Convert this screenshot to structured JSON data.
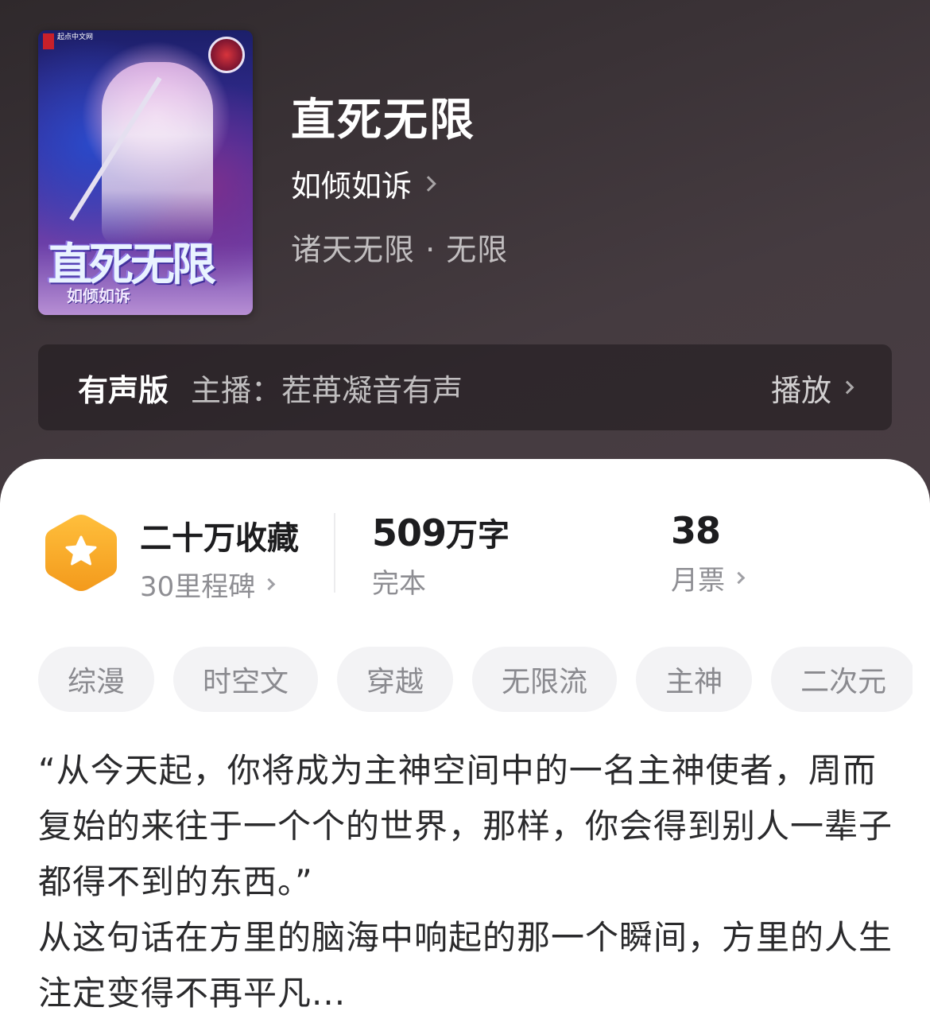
{
  "book": {
    "title": "直死无限",
    "author": "如倾如诉",
    "genre": "诸天无限 · 无限",
    "cover": {
      "title_art": "直死无限",
      "author_art": "如倾如诉",
      "publisher_text": "起点中文网"
    }
  },
  "audio": {
    "label": "有声版",
    "anchor": "主播：茬苒凝音有声",
    "play_label": "播放"
  },
  "stats": {
    "collection": {
      "main": "二十万收藏",
      "sub": "30里程碑",
      "icon": "star-badge-icon"
    },
    "words": {
      "number": "509",
      "unit": "万字",
      "sub": "完本"
    },
    "monthly_ticket": {
      "number": "38",
      "sub": "月票"
    }
  },
  "tags": [
    "综漫",
    "时空文",
    "穿越",
    "无限流",
    "主神",
    "二次元"
  ],
  "description": {
    "p1": "“从今天起，你将成为主神空间中的一名主神使者，周而复始的来往于一个个的世界，那样，你会得到别人一辈子都得不到的东西。”",
    "p2": "从这句话在方里的脑海中响起的那一个瞬间，方里的人生注定变得不再平凡..."
  },
  "colors": {
    "header_bg": "#453b40",
    "badge_orange": "#f5a623",
    "tag_bg": "#f3f3f5",
    "text_dark": "#1d1d1f",
    "text_gray": "#8e8e93"
  }
}
